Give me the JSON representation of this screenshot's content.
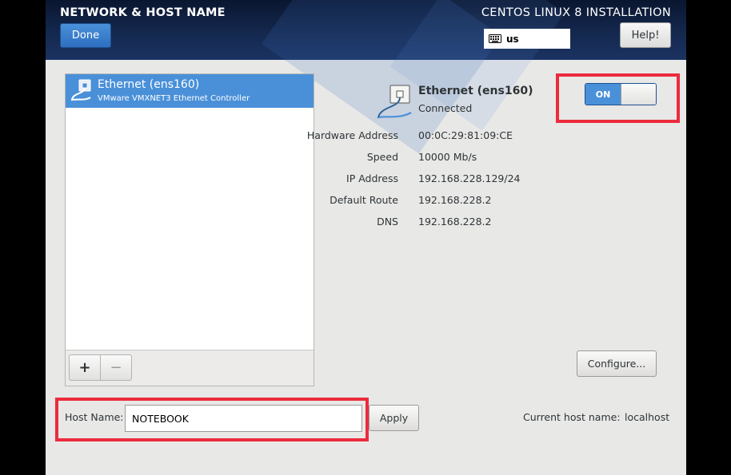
{
  "header": {
    "title": "NETWORK & HOST NAME",
    "product": "CENTOS LINUX 8 INSTALLATION",
    "done_label": "Done",
    "keyboard_layout": "us",
    "help_label": "Help!"
  },
  "device_list": {
    "items": [
      {
        "name": "Ethernet (ens160)",
        "description": "VMware VMXNET3 Ethernet Controller",
        "selected": true,
        "icon": "ethernet-icon"
      }
    ],
    "add_label": "+",
    "remove_label": "−"
  },
  "device_detail": {
    "name": "Ethernet (ens160)",
    "status": "Connected",
    "toggle_label": "ON",
    "toggle_state": "on",
    "rows": [
      {
        "label": "Hardware Address",
        "value": "00:0C:29:81:09:CE"
      },
      {
        "label": "Speed",
        "value": "10000 Mb/s"
      },
      {
        "label": "IP Address",
        "value": "192.168.228.129/24"
      },
      {
        "label": "Default Route",
        "value": "192.168.228.2"
      },
      {
        "label": "DNS",
        "value": "192.168.228.2"
      }
    ],
    "configure_label": "Configure..."
  },
  "hostname": {
    "label": "Host Name:",
    "value": "NOTEBOOK",
    "apply_label": "Apply",
    "current_label": "Current host name:",
    "current_value": "localhost"
  },
  "colors": {
    "accent": "#4a90d9",
    "highlight": "#ec2b3c",
    "header_bg": "#14284e",
    "panel_bg": "#e8e8e7"
  }
}
